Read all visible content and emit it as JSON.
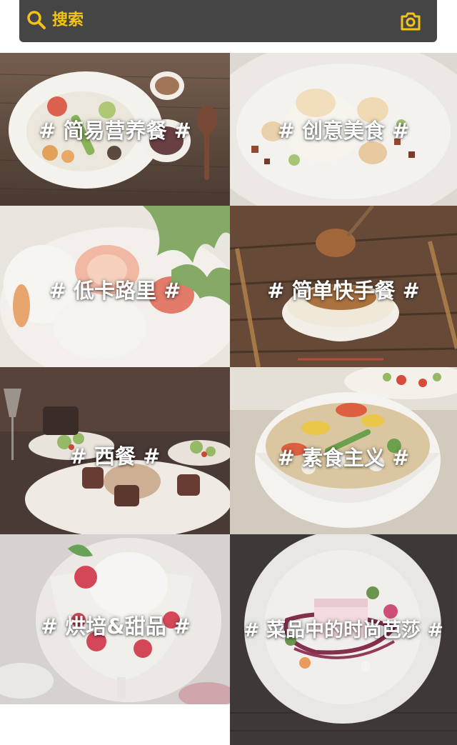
{
  "search": {
    "placeholder": "搜索",
    "search_icon": "search-icon",
    "camera_icon": "camera-icon",
    "accent_color": "#f2c319",
    "bar_color": "#454545"
  },
  "categories": [
    {
      "label": "# 简易营养餐 #"
    },
    {
      "label": "# 创意美食 #"
    },
    {
      "label": "# 低卡路里 #"
    },
    {
      "label": "# 简单快手餐 #"
    },
    {
      "label": "# 西餐 #"
    },
    {
      "label": "# 素食主义 #"
    },
    {
      "label": "# 烘培&甜品 #"
    },
    {
      "label": "# 菜品中的时尚芭莎 #"
    }
  ]
}
